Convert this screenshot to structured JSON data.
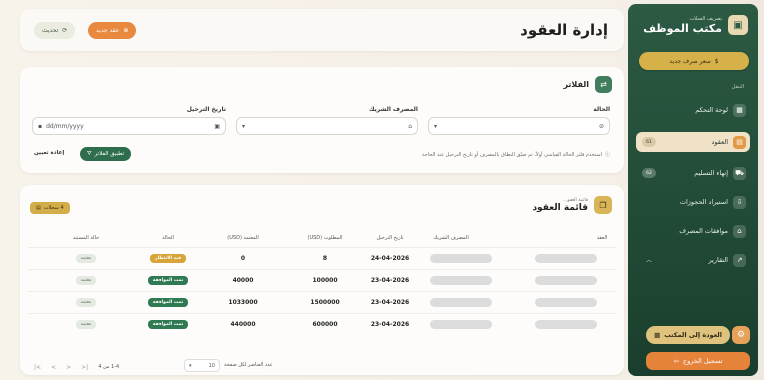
{
  "sidebar": {
    "subtitle": "تصريف العملات",
    "title": "مكتب الموظف",
    "logo_icon": "wallet-icon",
    "new_rate_button": "سعر صرف جديد",
    "nav_title": "التنقل",
    "items": [
      {
        "label": "لوحة التحكم",
        "icon": "dashboard-icon",
        "badge": ""
      },
      {
        "label": "العقود",
        "icon": "contract-icon",
        "badge": "61",
        "active": true
      },
      {
        "label": "إنهاء التسليم",
        "icon": "delivery-icon",
        "badge": "62"
      },
      {
        "label": "استيراد الحجوزات",
        "icon": "import-icon",
        "badge": ""
      },
      {
        "label": "موافقات المصرف",
        "icon": "bank-icon",
        "badge": ""
      },
      {
        "label": "التقارير",
        "icon": "reports-icon",
        "badge": ""
      }
    ],
    "back_button": "العودة إلى المكتب",
    "logout_button": "تسجيل الخروج"
  },
  "header": {
    "title": "إدارة العقود",
    "new_contract_button": "عقد جديد",
    "refresh_button": "تحديث"
  },
  "filters": {
    "title": "الفلاتر",
    "status_label": "الحالة",
    "bank_label": "المصرف الشريك",
    "date_label": "تاريخ الترحيل",
    "date_placeholder": "dd/mm/yyyy",
    "note": "استخدم فلتر الحالة القياسي أولاً، ثم ضيّق النطاق بالمصرف أو تاريخ الترحيل عند الحاجة",
    "apply_button": "تطبيق الفلاتر",
    "reset_button": "إعادة تعيين"
  },
  "list": {
    "subtitle": "قائمة العقو...",
    "title": "قائمة العقود",
    "count": "4 سجلات",
    "columns": [
      "العقد",
      "المصرف الشريك",
      "تاريخ الترحيل",
      "المطلوب (USD)",
      "المعتمد (USD)",
      "الحالة",
      "حالة المستند"
    ],
    "rows": [
      {
        "date": "24-04-2026",
        "required": "8",
        "approved": "0",
        "status": "قيد الانتظار",
        "status_color": "#d6a53a",
        "doc": "معتمد"
      },
      {
        "date": "23-04-2026",
        "required": "100000",
        "approved": "40000",
        "status": "تمت الموافقة",
        "status_color": "#2f7a52",
        "doc": "معتمد"
      },
      {
        "date": "23-04-2026",
        "required": "1500000",
        "approved": "1033000",
        "status": "تمت الموافقة",
        "status_color": "#2f7a52",
        "doc": "معتمد"
      },
      {
        "date": "23-04-2026",
        "required": "600000",
        "approved": "440000",
        "status": "تمت الموافقة",
        "status_color": "#2f7a52",
        "doc": "معتمد"
      }
    ]
  },
  "pagination": {
    "rows_label": "عدد العناصر لكل صفحة",
    "page_size": "10",
    "range": "1-4 من 4"
  }
}
